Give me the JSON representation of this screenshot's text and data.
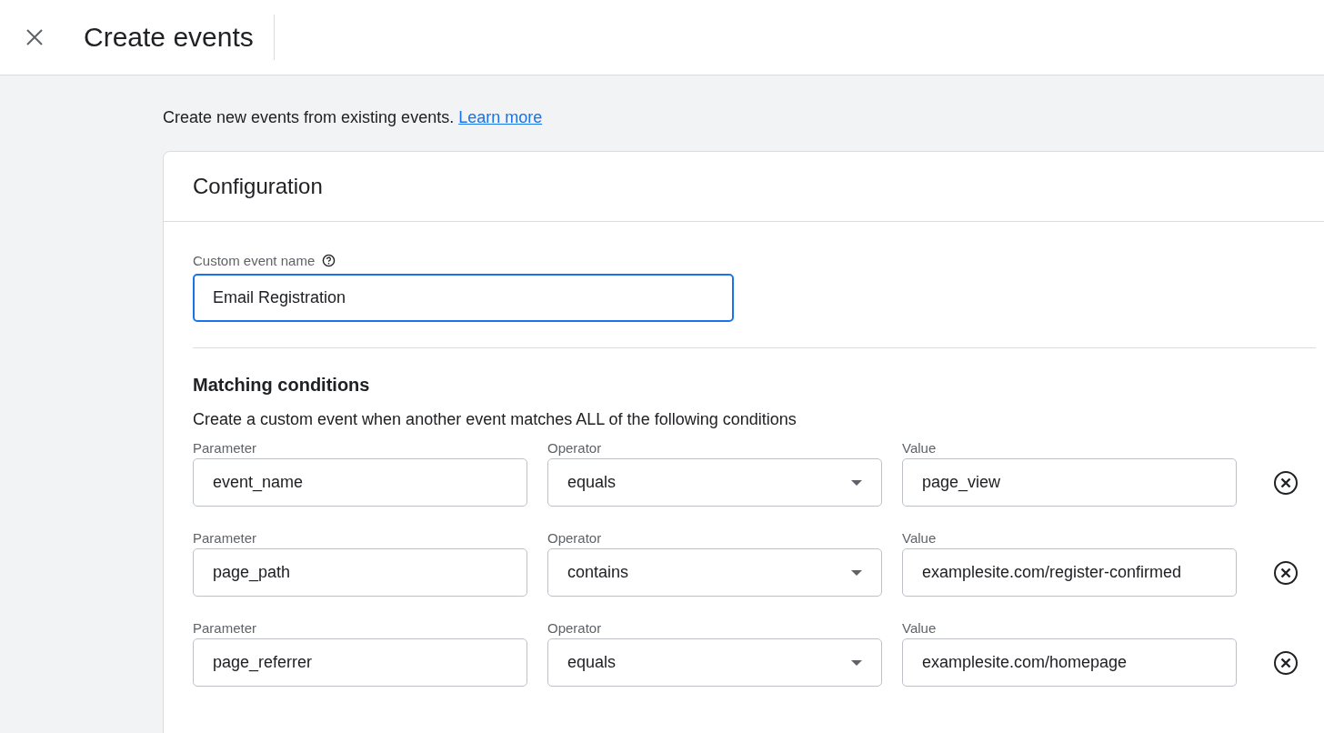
{
  "header": {
    "title": "Create events"
  },
  "intro": {
    "text": "Create new events from existing events.",
    "link": "Learn more"
  },
  "configuration": {
    "title": "Configuration",
    "event_name": {
      "label": "Custom event name",
      "value": "Email Registration",
      "focused": true
    },
    "matching": {
      "title": "Matching conditions",
      "description": "Create a custom event when another event matches ALL of the following conditions",
      "conditions": [
        {
          "parameter_label": "Parameter",
          "parameter": "event_name",
          "operator_label": "Operator",
          "operator": "equals",
          "value_label": "Value",
          "value": "page_view"
        },
        {
          "parameter_label": "Parameter",
          "parameter": "page_path",
          "operator_label": "Operator",
          "operator": "contains",
          "value_label": "Value",
          "value": "examplesite.com/register-confirmed"
        },
        {
          "parameter_label": "Parameter",
          "parameter": "page_referrer",
          "operator_label": "Operator",
          "operator": "equals",
          "value_label": "Value",
          "value": "examplesite.com/homepage"
        }
      ]
    }
  }
}
